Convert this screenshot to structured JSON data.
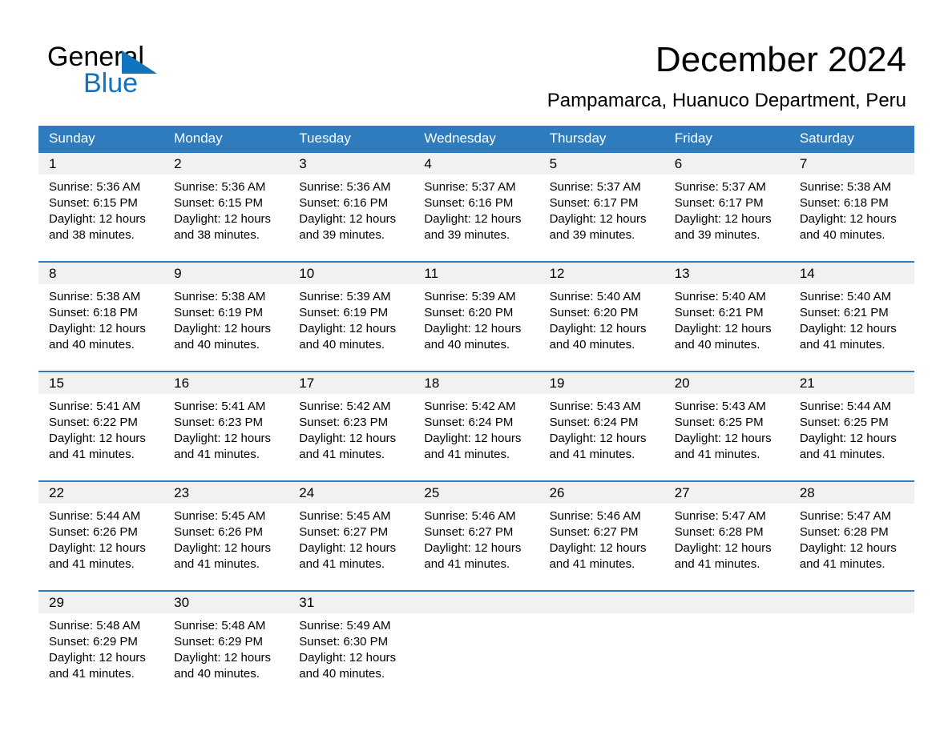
{
  "brand": {
    "name_part1": "General",
    "name_part2": "Blue",
    "triangle_color": "#1173bd"
  },
  "header": {
    "title": "December 2024",
    "subtitle": "Pampamarca, Huanuco Department, Peru"
  },
  "theme": {
    "header_blue": "#2e7cbe",
    "date_band_gray": "#f1f1f1",
    "text_black": "#000000",
    "header_text": "#ffffff"
  },
  "weekdays": [
    "Sunday",
    "Monday",
    "Tuesday",
    "Wednesday",
    "Thursday",
    "Friday",
    "Saturday"
  ],
  "weeks": [
    {
      "numbers": [
        "1",
        "2",
        "3",
        "4",
        "5",
        "6",
        "7"
      ],
      "days": [
        {
          "sunrise": "Sunrise: 5:36 AM",
          "sunset": "Sunset: 6:15 PM",
          "daylight1": "Daylight: 12 hours",
          "daylight2": "and 38 minutes."
        },
        {
          "sunrise": "Sunrise: 5:36 AM",
          "sunset": "Sunset: 6:15 PM",
          "daylight1": "Daylight: 12 hours",
          "daylight2": "and 38 minutes."
        },
        {
          "sunrise": "Sunrise: 5:36 AM",
          "sunset": "Sunset: 6:16 PM",
          "daylight1": "Daylight: 12 hours",
          "daylight2": "and 39 minutes."
        },
        {
          "sunrise": "Sunrise: 5:37 AM",
          "sunset": "Sunset: 6:16 PM",
          "daylight1": "Daylight: 12 hours",
          "daylight2": "and 39 minutes."
        },
        {
          "sunrise": "Sunrise: 5:37 AM",
          "sunset": "Sunset: 6:17 PM",
          "daylight1": "Daylight: 12 hours",
          "daylight2": "and 39 minutes."
        },
        {
          "sunrise": "Sunrise: 5:37 AM",
          "sunset": "Sunset: 6:17 PM",
          "daylight1": "Daylight: 12 hours",
          "daylight2": "and 39 minutes."
        },
        {
          "sunrise": "Sunrise: 5:38 AM",
          "sunset": "Sunset: 6:18 PM",
          "daylight1": "Daylight: 12 hours",
          "daylight2": "and 40 minutes."
        }
      ]
    },
    {
      "numbers": [
        "8",
        "9",
        "10",
        "11",
        "12",
        "13",
        "14"
      ],
      "days": [
        {
          "sunrise": "Sunrise: 5:38 AM",
          "sunset": "Sunset: 6:18 PM",
          "daylight1": "Daylight: 12 hours",
          "daylight2": "and 40 minutes."
        },
        {
          "sunrise": "Sunrise: 5:38 AM",
          "sunset": "Sunset: 6:19 PM",
          "daylight1": "Daylight: 12 hours",
          "daylight2": "and 40 minutes."
        },
        {
          "sunrise": "Sunrise: 5:39 AM",
          "sunset": "Sunset: 6:19 PM",
          "daylight1": "Daylight: 12 hours",
          "daylight2": "and 40 minutes."
        },
        {
          "sunrise": "Sunrise: 5:39 AM",
          "sunset": "Sunset: 6:20 PM",
          "daylight1": "Daylight: 12 hours",
          "daylight2": "and 40 minutes."
        },
        {
          "sunrise": "Sunrise: 5:40 AM",
          "sunset": "Sunset: 6:20 PM",
          "daylight1": "Daylight: 12 hours",
          "daylight2": "and 40 minutes."
        },
        {
          "sunrise": "Sunrise: 5:40 AM",
          "sunset": "Sunset: 6:21 PM",
          "daylight1": "Daylight: 12 hours",
          "daylight2": "and 40 minutes."
        },
        {
          "sunrise": "Sunrise: 5:40 AM",
          "sunset": "Sunset: 6:21 PM",
          "daylight1": "Daylight: 12 hours",
          "daylight2": "and 41 minutes."
        }
      ]
    },
    {
      "numbers": [
        "15",
        "16",
        "17",
        "18",
        "19",
        "20",
        "21"
      ],
      "days": [
        {
          "sunrise": "Sunrise: 5:41 AM",
          "sunset": "Sunset: 6:22 PM",
          "daylight1": "Daylight: 12 hours",
          "daylight2": "and 41 minutes."
        },
        {
          "sunrise": "Sunrise: 5:41 AM",
          "sunset": "Sunset: 6:23 PM",
          "daylight1": "Daylight: 12 hours",
          "daylight2": "and 41 minutes."
        },
        {
          "sunrise": "Sunrise: 5:42 AM",
          "sunset": "Sunset: 6:23 PM",
          "daylight1": "Daylight: 12 hours",
          "daylight2": "and 41 minutes."
        },
        {
          "sunrise": "Sunrise: 5:42 AM",
          "sunset": "Sunset: 6:24 PM",
          "daylight1": "Daylight: 12 hours",
          "daylight2": "and 41 minutes."
        },
        {
          "sunrise": "Sunrise: 5:43 AM",
          "sunset": "Sunset: 6:24 PM",
          "daylight1": "Daylight: 12 hours",
          "daylight2": "and 41 minutes."
        },
        {
          "sunrise": "Sunrise: 5:43 AM",
          "sunset": "Sunset: 6:25 PM",
          "daylight1": "Daylight: 12 hours",
          "daylight2": "and 41 minutes."
        },
        {
          "sunrise": "Sunrise: 5:44 AM",
          "sunset": "Sunset: 6:25 PM",
          "daylight1": "Daylight: 12 hours",
          "daylight2": "and 41 minutes."
        }
      ]
    },
    {
      "numbers": [
        "22",
        "23",
        "24",
        "25",
        "26",
        "27",
        "28"
      ],
      "days": [
        {
          "sunrise": "Sunrise: 5:44 AM",
          "sunset": "Sunset: 6:26 PM",
          "daylight1": "Daylight: 12 hours",
          "daylight2": "and 41 minutes."
        },
        {
          "sunrise": "Sunrise: 5:45 AM",
          "sunset": "Sunset: 6:26 PM",
          "daylight1": "Daylight: 12 hours",
          "daylight2": "and 41 minutes."
        },
        {
          "sunrise": "Sunrise: 5:45 AM",
          "sunset": "Sunset: 6:27 PM",
          "daylight1": "Daylight: 12 hours",
          "daylight2": "and 41 minutes."
        },
        {
          "sunrise": "Sunrise: 5:46 AM",
          "sunset": "Sunset: 6:27 PM",
          "daylight1": "Daylight: 12 hours",
          "daylight2": "and 41 minutes."
        },
        {
          "sunrise": "Sunrise: 5:46 AM",
          "sunset": "Sunset: 6:27 PM",
          "daylight1": "Daylight: 12 hours",
          "daylight2": "and 41 minutes."
        },
        {
          "sunrise": "Sunrise: 5:47 AM",
          "sunset": "Sunset: 6:28 PM",
          "daylight1": "Daylight: 12 hours",
          "daylight2": "and 41 minutes."
        },
        {
          "sunrise": "Sunrise: 5:47 AM",
          "sunset": "Sunset: 6:28 PM",
          "daylight1": "Daylight: 12 hours",
          "daylight2": "and 41 minutes."
        }
      ]
    },
    {
      "numbers": [
        "29",
        "30",
        "31",
        "",
        "",
        "",
        ""
      ],
      "days": [
        {
          "sunrise": "Sunrise: 5:48 AM",
          "sunset": "Sunset: 6:29 PM",
          "daylight1": "Daylight: 12 hours",
          "daylight2": "and 41 minutes."
        },
        {
          "sunrise": "Sunrise: 5:48 AM",
          "sunset": "Sunset: 6:29 PM",
          "daylight1": "Daylight: 12 hours",
          "daylight2": "and 40 minutes."
        },
        {
          "sunrise": "Sunrise: 5:49 AM",
          "sunset": "Sunset: 6:30 PM",
          "daylight1": "Daylight: 12 hours",
          "daylight2": "and 40 minutes."
        },
        {
          "sunrise": "",
          "sunset": "",
          "daylight1": "",
          "daylight2": ""
        },
        {
          "sunrise": "",
          "sunset": "",
          "daylight1": "",
          "daylight2": ""
        },
        {
          "sunrise": "",
          "sunset": "",
          "daylight1": "",
          "daylight2": ""
        },
        {
          "sunrise": "",
          "sunset": "",
          "daylight1": "",
          "daylight2": ""
        }
      ]
    }
  ]
}
